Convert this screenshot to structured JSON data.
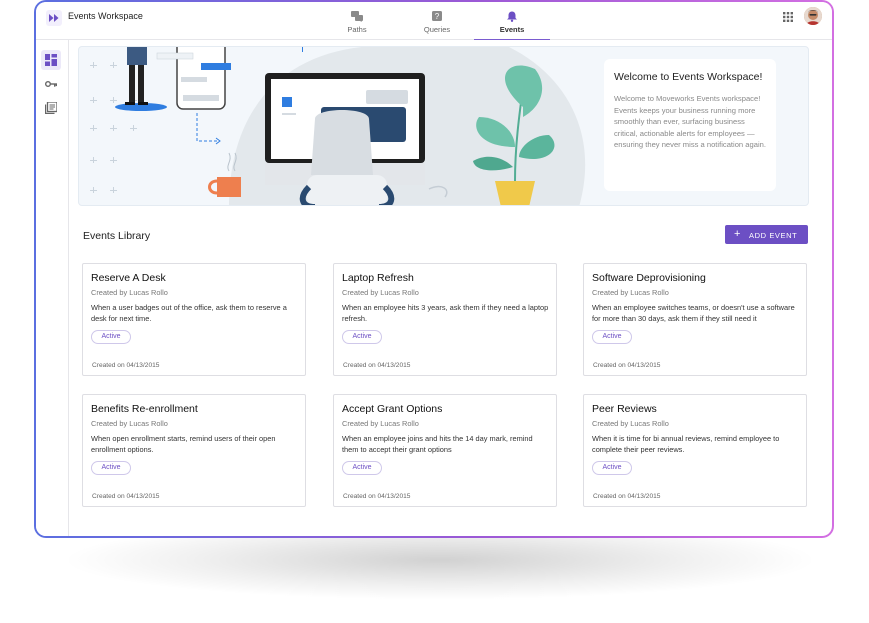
{
  "app": {
    "title": "Events Workspace"
  },
  "tabs": [
    {
      "label": "Paths",
      "icon": "chat-bubbles-icon"
    },
    {
      "label": "Queries",
      "icon": "question-box-icon"
    },
    {
      "label": "Events",
      "icon": "bell-icon",
      "active": true
    }
  ],
  "sidebar": {
    "items": [
      {
        "icon": "dashboard-icon",
        "active": true
      },
      {
        "icon": "key-icon"
      },
      {
        "icon": "library-icon"
      }
    ]
  },
  "hero": {
    "title": "Welcome to Events Workspace!",
    "body": "Welcome to Moveworks Events workspace! Events keeps your business running more smoothly than ever, surfacing business critical, actionable alerts for employees — ensuring they never miss a notification again."
  },
  "library": {
    "title": "Events Library",
    "add_button": "ADD EVENT"
  },
  "events": [
    {
      "title": "Reserve A Desk",
      "author": "Created by Lucas Rollo",
      "description": "When a user badges out of the office, ask them to reserve a desk for next time.",
      "status": "Active",
      "created": "Created on 04/13/2015"
    },
    {
      "title": "Laptop Refresh",
      "author": "Created by Lucas Rollo",
      "description": "When an employee hits 3 years, ask them if they need a laptop refresh.",
      "status": "Active",
      "created": "Created on 04/13/2015"
    },
    {
      "title": "Software Deprovisioning",
      "author": "Created by Lucas Rollo",
      "description": "When an employee switches teams, or doesn't use a software for more than 30 days, ask them if they still need it",
      "status": "Active",
      "created": "Created on 04/13/2015"
    },
    {
      "title": "Benefits Re-enrollment",
      "author": "Created by Lucas Rollo",
      "description": "When open enrollment starts, remind users of their open enrollment options.",
      "status": "Active",
      "created": "Created on 04/13/2015"
    },
    {
      "title": "Accept Grant Options",
      "author": "Created by Lucas Rollo",
      "description": "When an employee joins and hits the 14 day mark, remind them to accept their grant options",
      "status": "Active",
      "created": "Created on 04/13/2015"
    },
    {
      "title": "Peer Reviews",
      "author": "Created by Lucas Rollo",
      "description": "When it is time for bi annual reviews, remind employee to complete their peer reviews.",
      "status": "Active",
      "created": "Created on 04/13/2015"
    }
  ],
  "colors": {
    "accent": "#6c4fc4",
    "frame_start": "#5b6fe0",
    "frame_end": "#d36fe2"
  }
}
